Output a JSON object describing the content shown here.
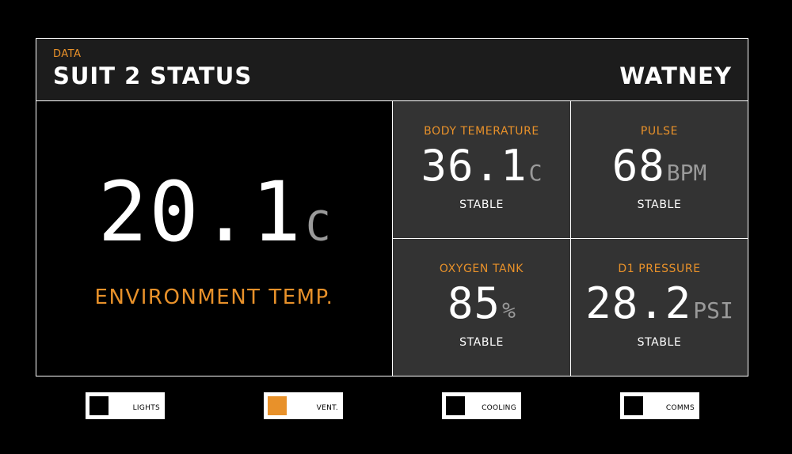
{
  "header": {
    "kicker": "DATA",
    "title": "SUIT 2 STATUS",
    "user": "WATNEY"
  },
  "environment": {
    "value": "20.1",
    "unit": "C",
    "label": "ENVIRONMENT TEMP."
  },
  "metrics": [
    {
      "label": "BODY TEMERATURE",
      "value": "36.1",
      "unit": "C",
      "status": "STABLE"
    },
    {
      "label": "PULSE",
      "value": "68",
      "unit": "BPM",
      "status": "STABLE"
    },
    {
      "label": "OXYGEN TANK",
      "value": "85",
      "unit": "%",
      "status": "STABLE"
    },
    {
      "label": "D1 PRESSURE",
      "value": "28.2",
      "unit": "PSI",
      "status": "STABLE"
    }
  ],
  "toggles": [
    {
      "label": "LIGHTS",
      "on": false
    },
    {
      "label": "VENT.",
      "on": true
    },
    {
      "label": "COOLING",
      "on": false
    },
    {
      "label": "COMMS",
      "on": false
    }
  ],
  "colors": {
    "accent": "#e8912a",
    "background": "#000000",
    "header_bg": "#1c1c1c",
    "cell_bg": "#333333",
    "unit_gray": "#9a9a9a"
  }
}
